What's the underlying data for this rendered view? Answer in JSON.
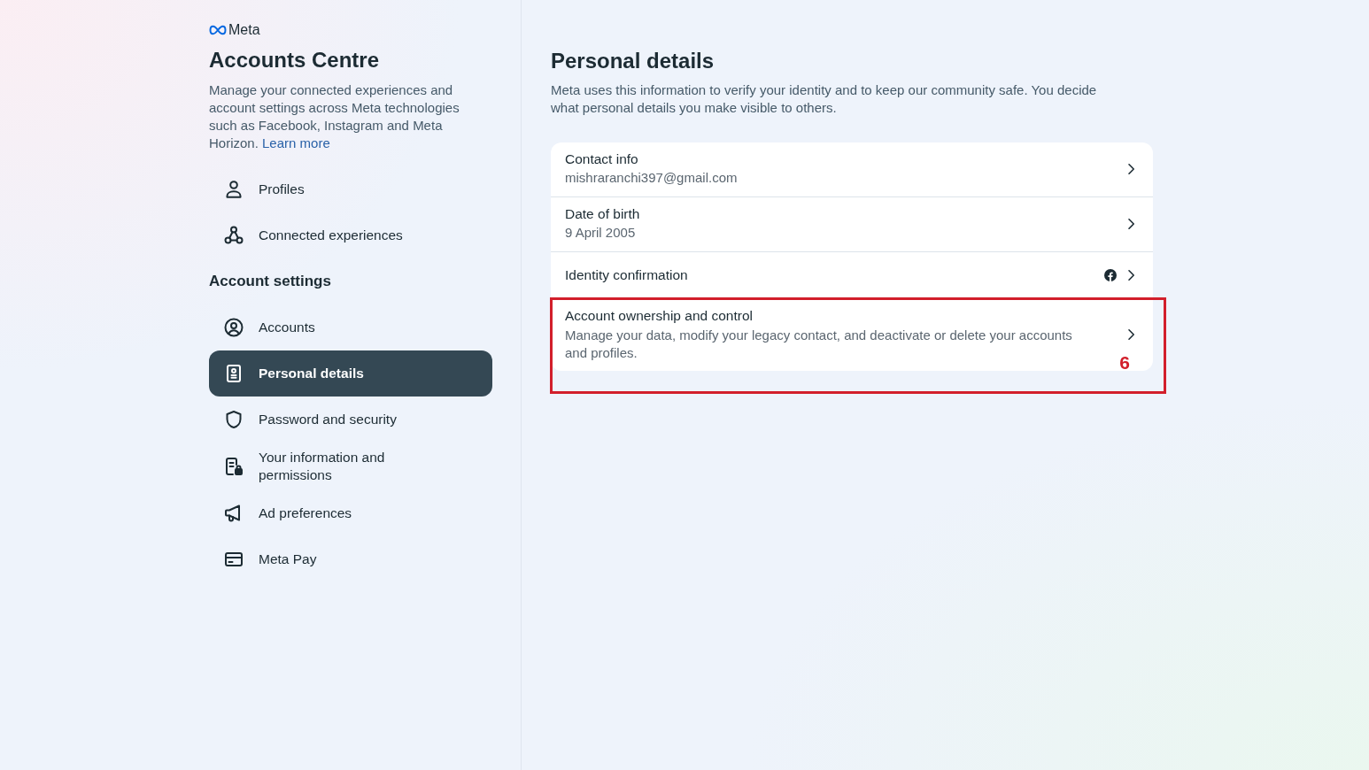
{
  "brand": {
    "name": "Meta"
  },
  "sidebar": {
    "title": "Accounts Centre",
    "description": "Manage your connected experiences and account settings across Meta technologies such as Facebook, Instagram and Meta Horizon.",
    "link": "Learn more",
    "sections": [
      {
        "items": [
          {
            "label": "Profiles",
            "selected": false
          },
          {
            "label": "Connected experiences",
            "selected": false
          }
        ]
      },
      {
        "heading": "Account settings",
        "items": [
          {
            "label": "Accounts",
            "selected": false
          },
          {
            "label": "Personal details",
            "selected": true
          },
          {
            "label": "Password and security",
            "selected": false
          },
          {
            "label": "Your information and permissions",
            "selected": false
          },
          {
            "label": "Ad preferences",
            "selected": false
          },
          {
            "label": "Meta Pay",
            "selected": false
          }
        ]
      }
    ]
  },
  "main": {
    "title": "Personal details",
    "description": "Meta uses this information to verify your identity and to keep our community safe. You decide what personal details you make visible to others.",
    "rows": [
      {
        "kind": "value",
        "title": "Contact info",
        "value": "mishraranchi397@gmail.com"
      },
      {
        "kind": "value",
        "title": "Date of birth",
        "value": "9 April 2005"
      },
      {
        "kind": "linked",
        "title": "Identity confirmation"
      },
      {
        "kind": "summary",
        "title": "Account ownership and control",
        "value": "Manage your data, modify your legacy contact, and deactivate or delete your accounts and profiles.",
        "annotation": "6"
      }
    ]
  }
}
